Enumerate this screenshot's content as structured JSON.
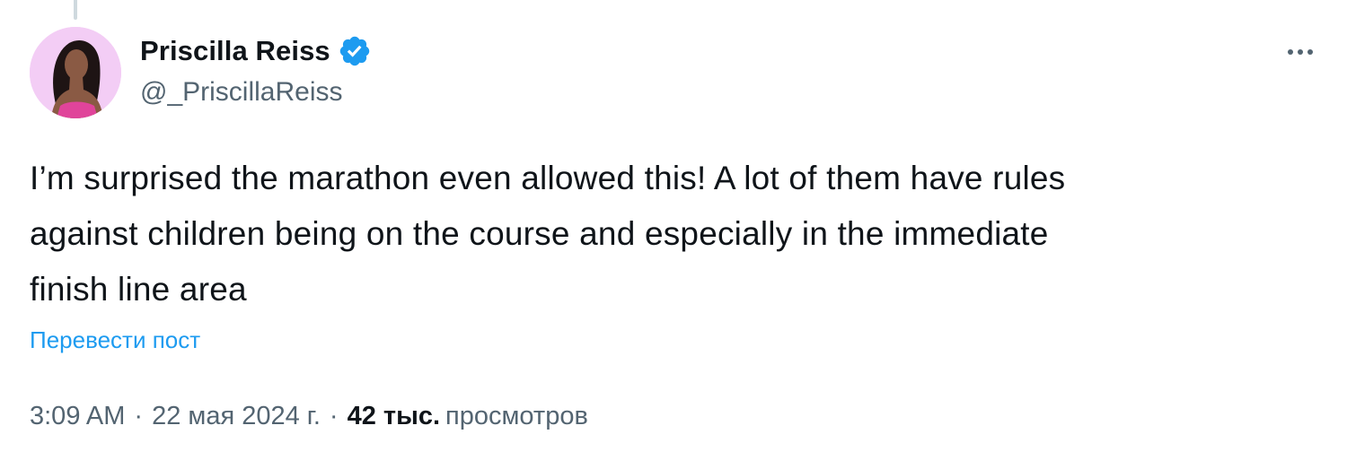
{
  "tweet": {
    "author": {
      "display_name": "Priscilla Reiss",
      "handle": "@_PriscillaReiss",
      "verified": true,
      "avatar_icon": "profile-photo"
    },
    "more_icon": "more-horizontal-icon",
    "text": "I’m surprised the marathon even allowed this! A lot of them have rules\nagainst children being on the course and especially in the immediate\nfinish line area",
    "translate_label": "Перевести пост",
    "time": "3:09 AM",
    "separator": "·",
    "date": "22 мая 2024 г.",
    "views_count": "42 тыс.",
    "views_label": "просмотров"
  },
  "colors": {
    "text_primary": "#0f1419",
    "text_secondary": "#536471",
    "accent": "#1d9bf0",
    "avatar_bg": "#f3cdf5"
  }
}
